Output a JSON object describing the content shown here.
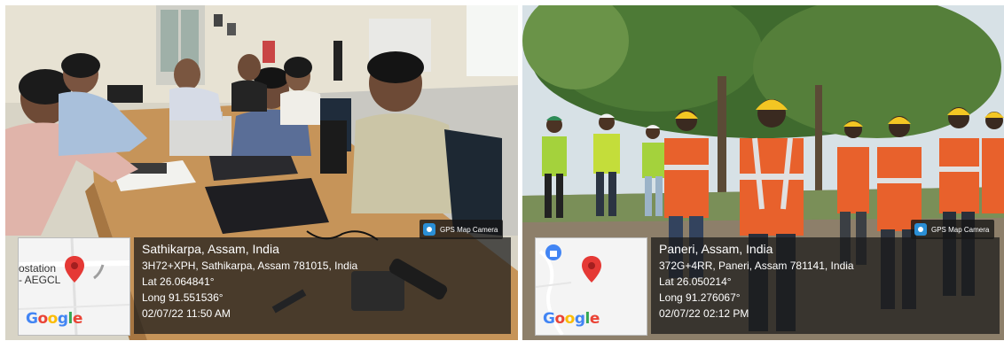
{
  "left": {
    "camera_badge": "GPS Map Camera",
    "map_label_line1": "ostation",
    "map_label_line2": "- AEGCL",
    "google_logo": "Google",
    "place": "Sathikarpa, Assam, India",
    "address": "3H72+XPH, Sathikarpa, Assam 781015, India",
    "lat": "Lat 26.064841°",
    "long": "Long 91.551536°",
    "datetime": "02/07/22 11:50 AM"
  },
  "right": {
    "camera_badge": "GPS Map Camera",
    "google_logo": "Google",
    "place": "Paneri, Assam, India",
    "address": "372G+4RR, Paneri, Assam 781141, India",
    "lat": "Lat 26.050214°",
    "long": "Long 91.276067°",
    "datetime": "02/07/22 02:12 PM"
  },
  "colors": {
    "pin_red": "#e53935",
    "overlay_dark": "#191919",
    "vest_orange": "#e8612c",
    "vest_green": "#a4d23c",
    "helmet_yellow": "#f3c623"
  }
}
